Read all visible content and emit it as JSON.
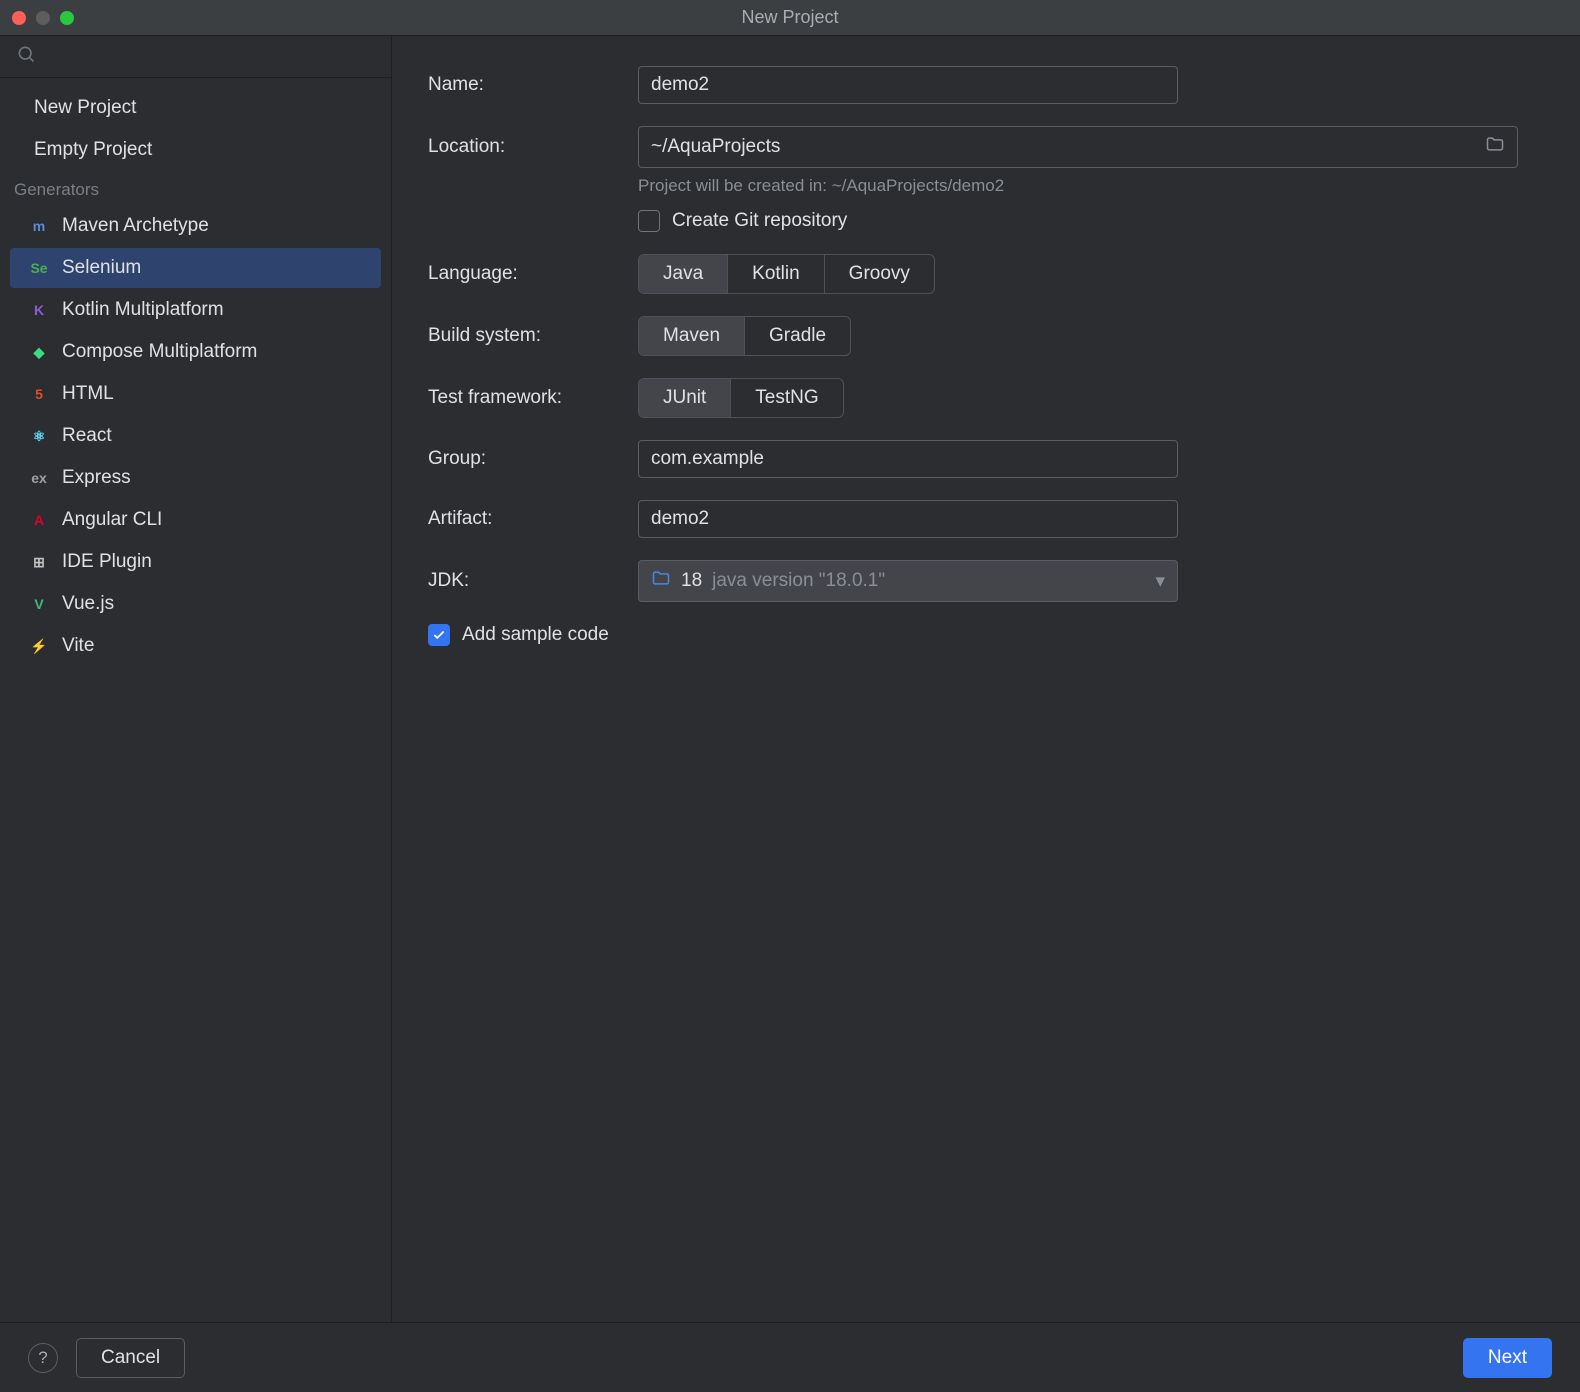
{
  "window": {
    "title": "New Project"
  },
  "sidebar": {
    "items": [
      {
        "label": "New Project"
      },
      {
        "label": "Empty Project"
      }
    ],
    "section_label": "Generators",
    "generators": [
      {
        "label": "Maven Archetype",
        "icon": "maven-icon",
        "color": "#5a8bd6",
        "glyph": "m"
      },
      {
        "label": "Selenium",
        "icon": "selenium-icon",
        "color": "#4caf50",
        "glyph": "Se"
      },
      {
        "label": "Kotlin Multiplatform",
        "icon": "kotlin-icon",
        "color": "#8e5bd6",
        "glyph": "K"
      },
      {
        "label": "Compose Multiplatform",
        "icon": "compose-icon",
        "color": "#3ddc84",
        "glyph": "◆"
      },
      {
        "label": "HTML",
        "icon": "html-icon",
        "color": "#e44d26",
        "glyph": "5"
      },
      {
        "label": "React",
        "icon": "react-icon",
        "color": "#61dafb",
        "glyph": "⚛"
      },
      {
        "label": "Express",
        "icon": "express-icon",
        "color": "#a0a0a0",
        "glyph": "ex"
      },
      {
        "label": "Angular CLI",
        "icon": "angular-icon",
        "color": "#dd0031",
        "glyph": "A"
      },
      {
        "label": "IDE Plugin",
        "icon": "ide-plugin-icon",
        "color": "#c0c0c0",
        "glyph": "⊞"
      },
      {
        "label": "Vue.js",
        "icon": "vue-icon",
        "color": "#41b883",
        "glyph": "V"
      },
      {
        "label": "Vite",
        "icon": "vite-icon",
        "color": "#ffca28",
        "glyph": "⚡"
      }
    ],
    "selected_generator": 1
  },
  "form": {
    "name_label": "Name:",
    "name_value": "demo2",
    "location_label": "Location:",
    "location_value": "~/AquaProjects",
    "location_hint": "Project will be created in: ~/AquaProjects/demo2",
    "git_label": "Create Git repository",
    "git_checked": false,
    "language_label": "Language:",
    "language_options": [
      "Java",
      "Kotlin",
      "Groovy"
    ],
    "language_selected": 0,
    "build_label": "Build system:",
    "build_options": [
      "Maven",
      "Gradle"
    ],
    "build_selected": 0,
    "test_label": "Test framework:",
    "test_options": [
      "JUnit",
      "TestNG"
    ],
    "test_selected": 0,
    "group_label": "Group:",
    "group_value": "com.example",
    "artifact_label": "Artifact:",
    "artifact_value": "demo2",
    "jdk_label": "JDK:",
    "jdk_value": "18",
    "jdk_version": "java version \"18.0.1\"",
    "sample_label": "Add sample code",
    "sample_checked": true
  },
  "footer": {
    "help": "?",
    "cancel": "Cancel",
    "next": "Next"
  }
}
